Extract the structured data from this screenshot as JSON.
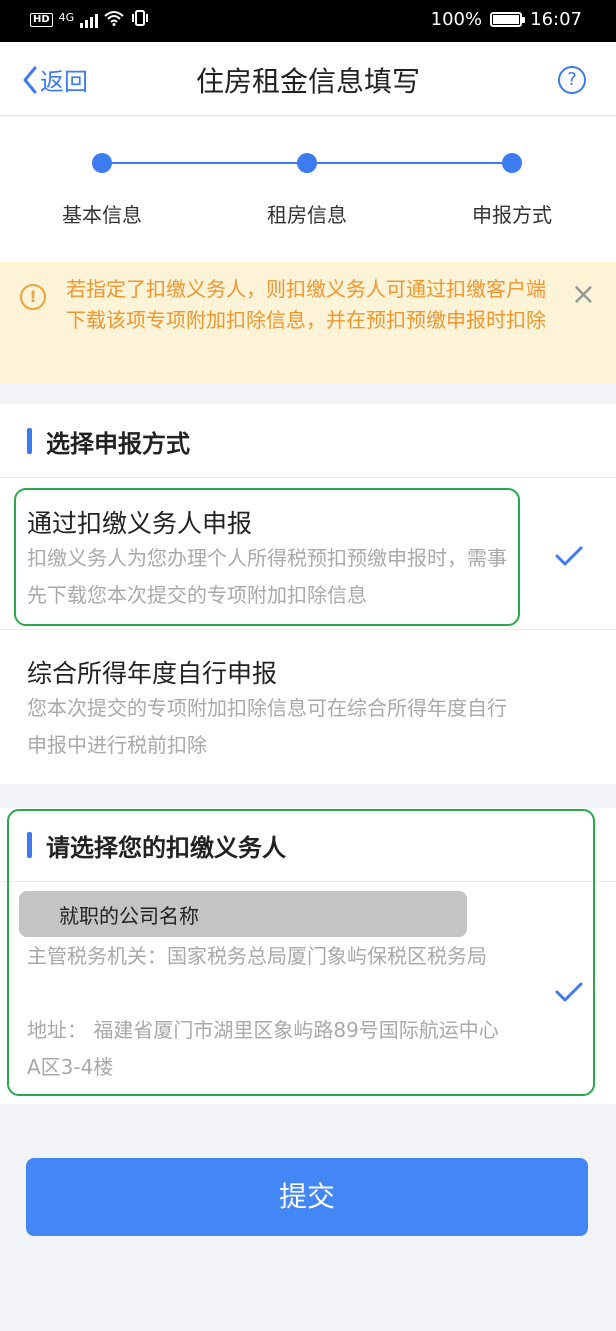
{
  "status_bar": {
    "hd": "HD",
    "network": "4G",
    "battery": "100%",
    "time": "16:07"
  },
  "nav": {
    "back_label": "返回",
    "title": "住房租金信息填写",
    "help_symbol": "?"
  },
  "steps": [
    {
      "label": "基本信息"
    },
    {
      "label": "租房信息"
    },
    {
      "label": "申报方式"
    }
  ],
  "notice": {
    "icon_symbol": "!",
    "text": "若指定了扣缴义务人，则扣缴义务人可通过扣缴客户端下载该项专项附加扣除信息，并在预扣预缴申报时扣除",
    "close_symbol": "×"
  },
  "report_method": {
    "section_title": "选择申报方式",
    "options": [
      {
        "title": "通过扣缴义务人申报",
        "desc": "扣缴义务人为您办理个人所得税预扣预缴申报时，需事先下载您本次提交的专项附加扣除信息",
        "selected": true
      },
      {
        "title": "综合所得年度自行申报",
        "desc": "您本次提交的专项附加扣除信息可在综合所得年度自行申报中进行税前扣除",
        "selected": false
      }
    ]
  },
  "withholding": {
    "section_title": "请选择您的扣缴义务人",
    "company_name": "就职的公司名称",
    "tax_authority": "主管税务机关：国家税务总局厦门象屿保税区税务局",
    "address": "地址： 福建省厦门市湖里区象屿路89号国际航运中心A区3-4楼",
    "selected": true
  },
  "submit_label": "提交",
  "colors": {
    "accent": "#3d7bf0",
    "notice_text": "#f0962f",
    "notice_bg": "#fdf3d7",
    "highlight_border": "#2aa84a"
  }
}
